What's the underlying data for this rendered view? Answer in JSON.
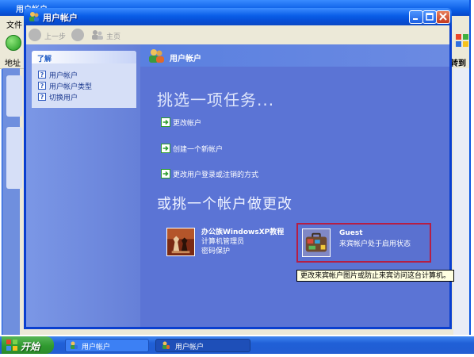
{
  "background_window": {
    "title": "用户帐户",
    "menu_file": "文件",
    "address_label": "地址",
    "go_label": "转到"
  },
  "window": {
    "title": "用户帐户",
    "toolbar": {
      "back_label": "上一步",
      "home_label": "主页"
    }
  },
  "sidebar": {
    "learn_title": "了解",
    "items": [
      {
        "label": "用户帐户"
      },
      {
        "label": "用户帐户类型"
      },
      {
        "label": "切换用户"
      }
    ]
  },
  "main": {
    "header_title": "用户帐户",
    "task_heading": "挑选一项任务...",
    "tasks": [
      {
        "label": "更改帐户"
      },
      {
        "label": "创建一个新帐户"
      },
      {
        "label": "更改用户登录或注销的方式"
      }
    ],
    "account_heading": "或挑一个帐户做更改",
    "accounts": [
      {
        "name": "办公族WindowsXP教程",
        "type": "计算机管理员",
        "detail": "密码保护"
      },
      {
        "name": "Guest",
        "status": "来宾帐户处于启用状态"
      }
    ],
    "tooltip": "更改来宾帐户图片或防止来宾访问这台计算机。"
  },
  "taskbar": {
    "start_label": "开始",
    "buttons": [
      {
        "label": "用户帐户"
      },
      {
        "label": "用户帐户"
      }
    ]
  },
  "colors": {
    "titlebar_blue": "#0a5ee8",
    "main_blue": "#5b74d5",
    "highlight_red": "#b51e44",
    "start_green": "#2f9a2f"
  }
}
